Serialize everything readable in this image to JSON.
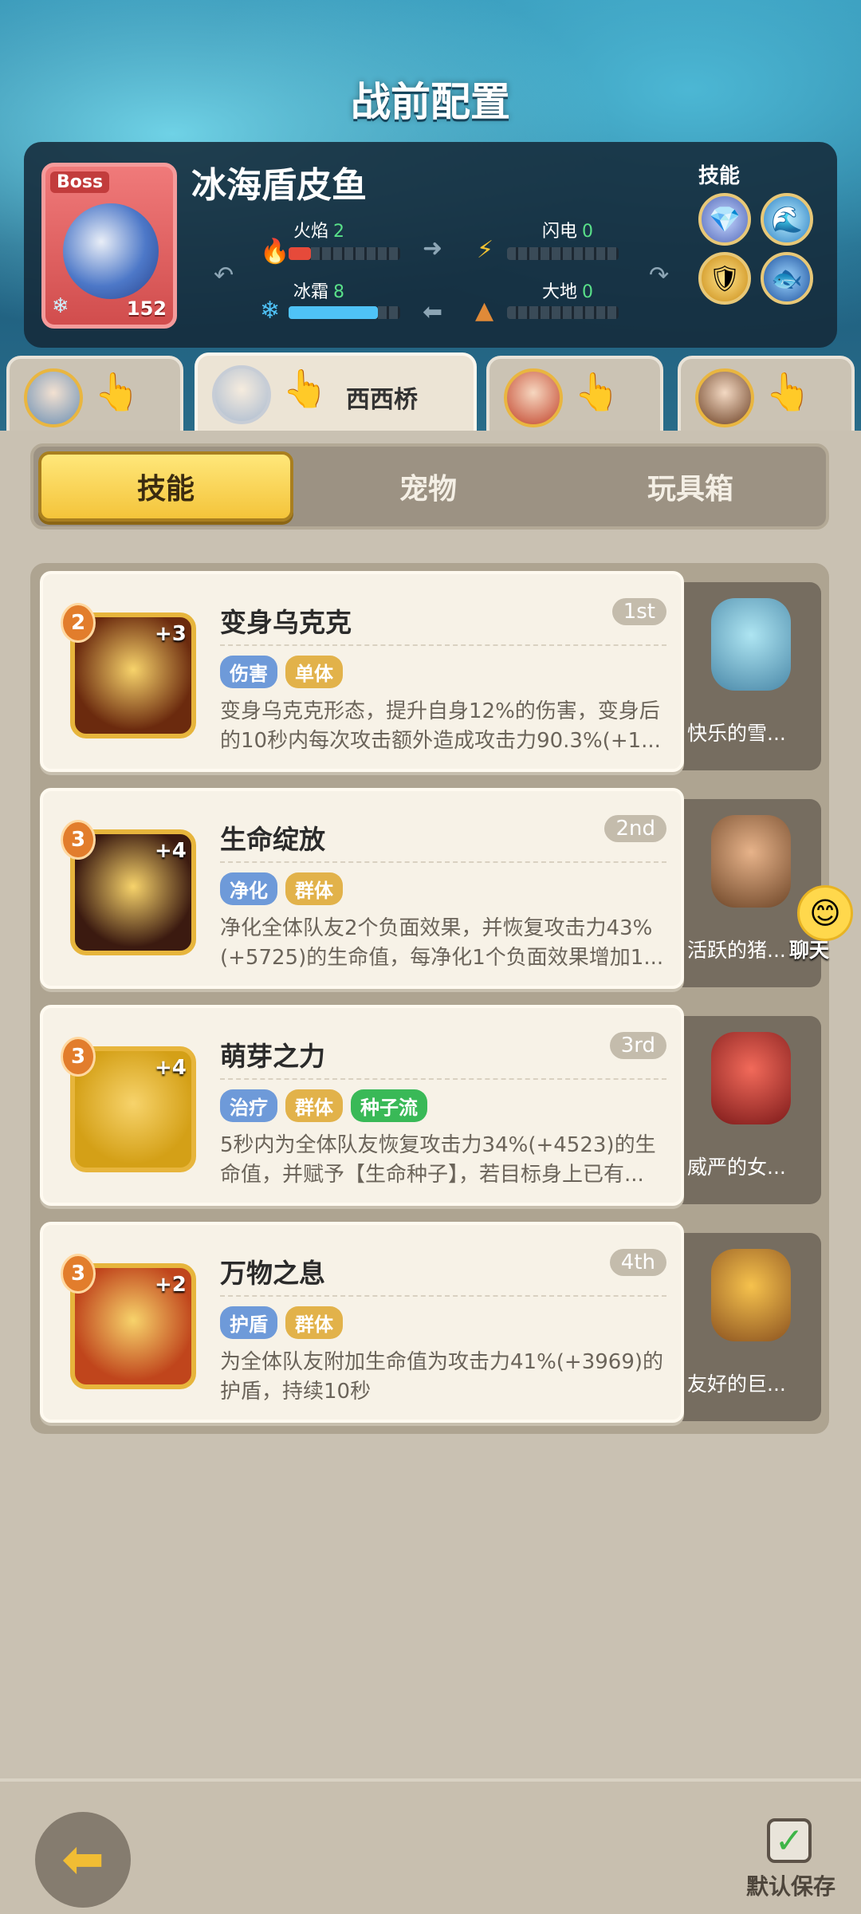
{
  "page": {
    "title": "战前配置"
  },
  "boss": {
    "tag": "Boss",
    "name": "冰海盾皮鱼",
    "level": "152",
    "skills_label": "技能",
    "attributes": [
      {
        "label": "火焰",
        "value": "2",
        "level_fraction": 0.2,
        "color": "#e64a3a"
      },
      {
        "label": "闪电",
        "value": "0",
        "level_fraction": 0.0,
        "color": "#f1c232"
      },
      {
        "label": "冰霜",
        "value": "8",
        "level_fraction": 0.8,
        "color": "#4fc3f7"
      },
      {
        "label": "大地",
        "value": "0",
        "level_fraction": 0.0,
        "color": "#e08a38"
      }
    ]
  },
  "hero_tabs": [
    {
      "label": ""
    },
    {
      "label": "西西桥"
    },
    {
      "label": ""
    },
    {
      "label": ""
    }
  ],
  "segments": [
    {
      "label": "技能",
      "active": true
    },
    {
      "label": "宠物",
      "active": false
    },
    {
      "label": "玩具箱",
      "active": false
    }
  ],
  "skills": [
    {
      "title": "变身乌克克",
      "order": "1st",
      "level": "2",
      "plus": "+3",
      "tags": [
        {
          "text": "伤害",
          "color": "blue"
        },
        {
          "text": "单体",
          "color": "gold"
        }
      ],
      "desc": "变身乌克克形态，提升自身12%的伤害，变身后的10秒内每次攻击额外造成攻击力90.3%(+1...",
      "pet_name": "快乐的雪...",
      "icon_color": "#6b2a0e"
    },
    {
      "title": "生命绽放",
      "order": "2nd",
      "level": "3",
      "plus": "+4",
      "tags": [
        {
          "text": "净化",
          "color": "blue"
        },
        {
          "text": "群体",
          "color": "gold"
        }
      ],
      "desc": "净化全体队友2个负面效果，并恢复攻击力43%(+5725)的生命值，每净化1个负面效果增加1...",
      "pet_name": "活跃的猪...",
      "icon_color": "#3b1a10"
    },
    {
      "title": "萌芽之力",
      "order": "3rd",
      "level": "3",
      "plus": "+4",
      "tags": [
        {
          "text": "治疗",
          "color": "blue"
        },
        {
          "text": "群体",
          "color": "gold"
        },
        {
          "text": "种子流",
          "color": "green"
        }
      ],
      "desc": "5秒内为全体队友恢复攻击力34%(+4523)的生命值，并赋予【生命种子】，若目标身上已有...",
      "pet_name": "威严的女...",
      "icon_color": "#d4a017"
    },
    {
      "title": "万物之息",
      "order": "4th",
      "level": "3",
      "plus": "+2",
      "tags": [
        {
          "text": "护盾",
          "color": "blue"
        },
        {
          "text": "群体",
          "color": "gold"
        }
      ],
      "desc": "为全体队友附加生命值为攻击力41%(+3969)的护盾，持续10秒",
      "pet_name": "友好的巨...",
      "icon_color": "#c0451c"
    }
  ],
  "chat": {
    "label": "聊天"
  },
  "footer": {
    "save_label": "默认保存"
  }
}
